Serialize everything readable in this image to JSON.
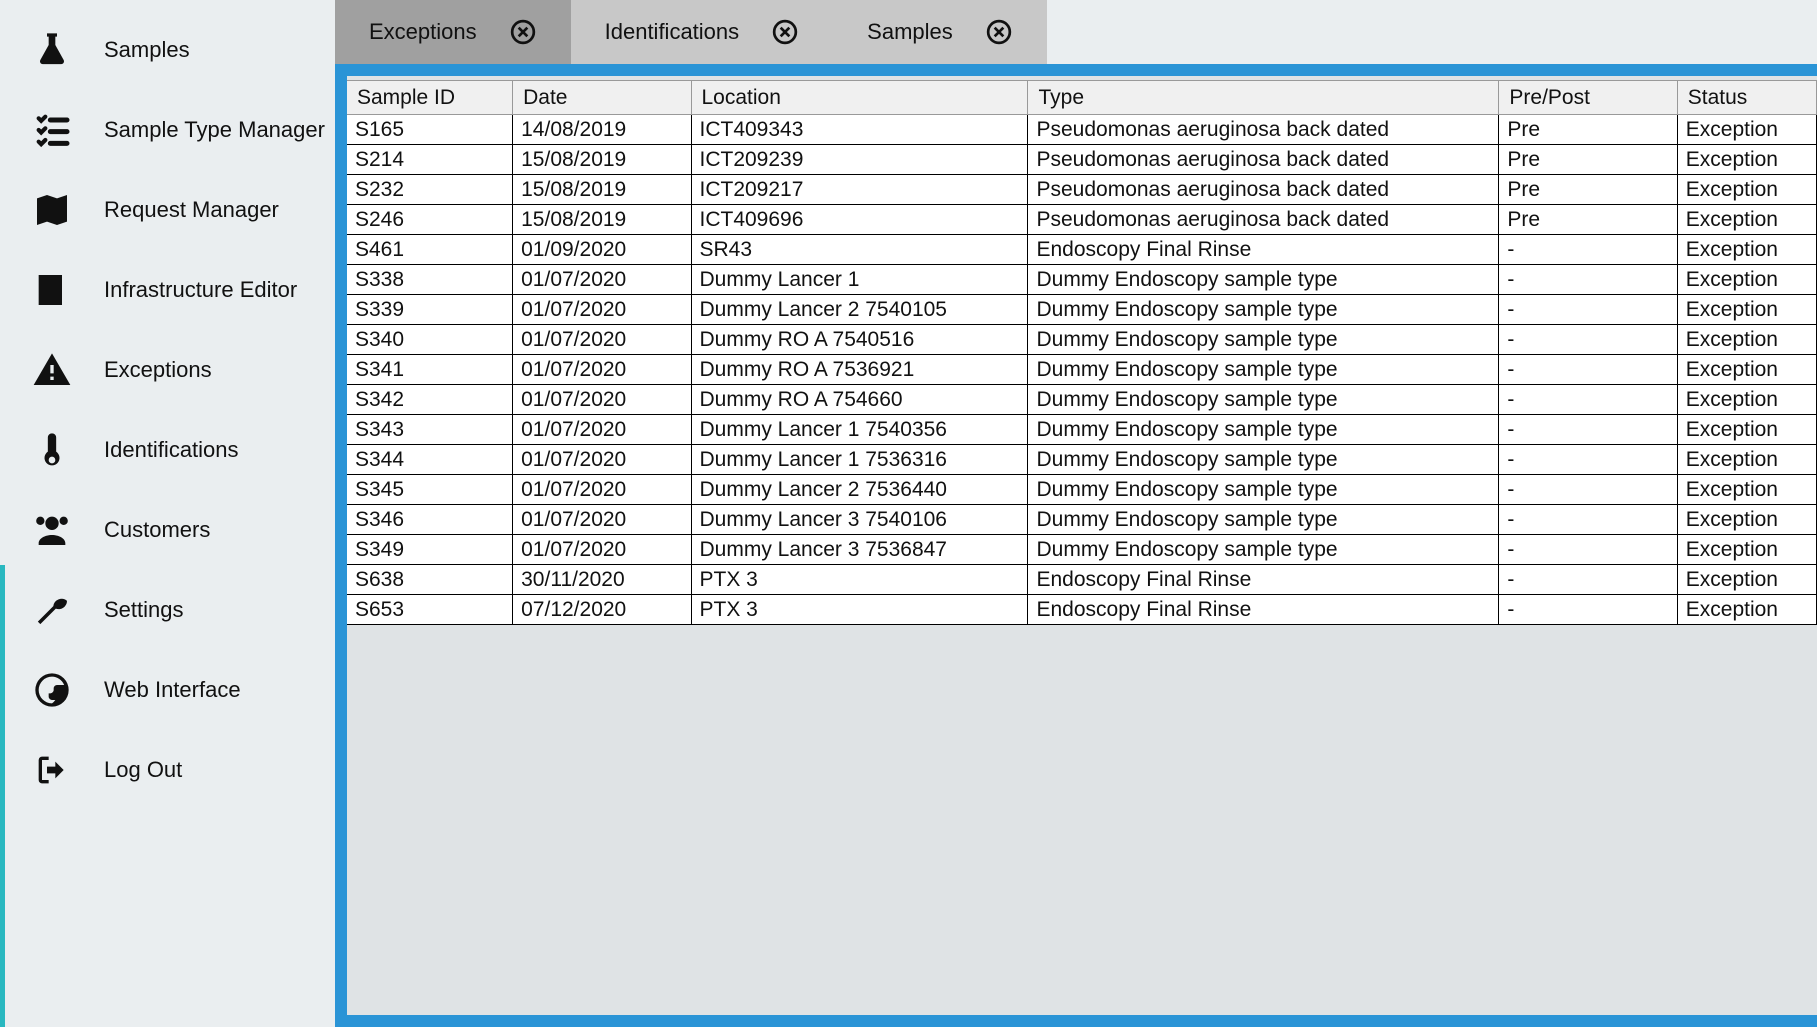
{
  "sidebar": {
    "items": [
      {
        "label": "Samples",
        "icon": "flask-icon"
      },
      {
        "label": "Sample Type Manager",
        "icon": "list-check-icon"
      },
      {
        "label": "Request Manager",
        "icon": "map-icon"
      },
      {
        "label": "Infrastructure Editor",
        "icon": "building-icon"
      },
      {
        "label": "Exceptions",
        "icon": "alert-icon"
      },
      {
        "label": "Identifications",
        "icon": "thermometer-icon"
      },
      {
        "label": "Customers",
        "icon": "users-icon"
      },
      {
        "label": "Settings",
        "icon": "wrench-icon"
      },
      {
        "label": "Web Interface",
        "icon": "globe-icon"
      },
      {
        "label": "Log Out",
        "icon": "logout-icon"
      }
    ]
  },
  "tabs": [
    {
      "label": "Exceptions",
      "active": true
    },
    {
      "label": "Identifications",
      "active": false
    },
    {
      "label": "Samples",
      "active": false
    }
  ],
  "table": {
    "headers": [
      "Sample ID",
      "Date",
      "Location",
      "Type",
      "Pre/Post",
      "Status"
    ],
    "rows": [
      [
        "S165",
        "14/08/2019",
        "ICT409343",
        "Pseudomonas aeruginosa back dated",
        "Pre",
        "Exception"
      ],
      [
        "S214",
        "15/08/2019",
        "ICT209239",
        "Pseudomonas aeruginosa back dated",
        "Pre",
        "Exception"
      ],
      [
        "S232",
        "15/08/2019",
        "ICT209217",
        "Pseudomonas aeruginosa back dated",
        "Pre",
        "Exception"
      ],
      [
        "S246",
        "15/08/2019",
        "ICT409696",
        "Pseudomonas aeruginosa back dated",
        "Pre",
        "Exception"
      ],
      [
        "S461",
        "01/09/2020",
        "SR43",
        "Endoscopy Final Rinse",
        "-",
        "Exception"
      ],
      [
        "S338",
        "01/07/2020",
        "Dummy Lancer 1",
        "Dummy Endoscopy sample type",
        "-",
        "Exception"
      ],
      [
        "S339",
        "01/07/2020",
        "Dummy Lancer 2 7540105",
        "Dummy Endoscopy sample type",
        "-",
        "Exception"
      ],
      [
        "S340",
        "01/07/2020",
        "Dummy RO A 7540516",
        "Dummy Endoscopy sample type",
        "-",
        "Exception"
      ],
      [
        "S341",
        "01/07/2020",
        "Dummy RO A 7536921",
        "Dummy Endoscopy sample type",
        "-",
        "Exception"
      ],
      [
        "S342",
        "01/07/2020",
        "Dummy RO A 754660",
        "Dummy Endoscopy sample type",
        "-",
        "Exception"
      ],
      [
        "S343",
        "01/07/2020",
        "Dummy Lancer 1 7540356",
        "Dummy Endoscopy sample type",
        "-",
        "Exception"
      ],
      [
        "S344",
        "01/07/2020",
        "Dummy Lancer 1 7536316",
        "Dummy Endoscopy sample type",
        "-",
        "Exception"
      ],
      [
        "S345",
        "01/07/2020",
        "Dummy Lancer 2 7536440",
        "Dummy Endoscopy sample type",
        "-",
        "Exception"
      ],
      [
        "S346",
        "01/07/2020",
        "Dummy Lancer 3 7540106",
        "Dummy Endoscopy sample type",
        "-",
        "Exception"
      ],
      [
        "S349",
        "01/07/2020",
        "Dummy Lancer 3 7536847",
        "Dummy Endoscopy sample type",
        "-",
        "Exception"
      ],
      [
        "S638",
        "30/11/2020",
        "PTX 3",
        "Endoscopy Final Rinse",
        "-",
        "Exception"
      ],
      [
        "S653",
        "07/12/2020",
        "PTX 3",
        "Endoscopy Final Rinse",
        "-",
        "Exception"
      ]
    ]
  }
}
